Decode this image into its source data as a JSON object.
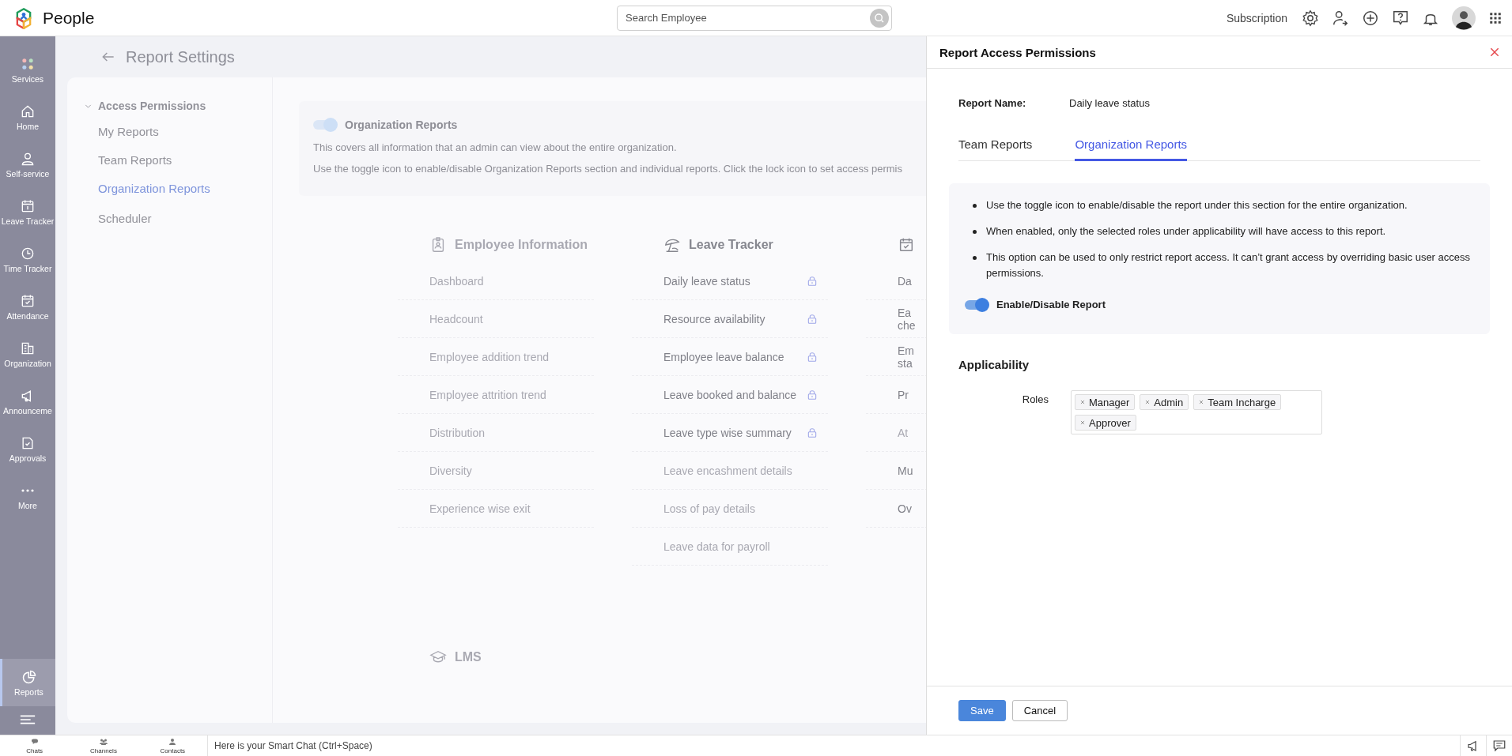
{
  "topbar": {
    "app_name": "People",
    "search": {
      "placeholder": "Search Employee"
    },
    "subscription": "Subscription"
  },
  "sidebar": {
    "items": [
      {
        "label": "Services",
        "selected": false
      },
      {
        "label": "Home",
        "selected": false
      },
      {
        "label": "Self-service",
        "selected": false
      },
      {
        "label": "Leave Tracker",
        "selected": false
      },
      {
        "label": "Time Tracker",
        "selected": false
      },
      {
        "label": "Attendance",
        "selected": false
      },
      {
        "label": "Organization",
        "selected": false
      },
      {
        "label": "Announceme",
        "selected": false
      },
      {
        "label": "Approvals",
        "selected": false
      },
      {
        "label": "More",
        "selected": false
      }
    ],
    "bottom_items": [
      {
        "label": "Reports",
        "selected": true
      }
    ]
  },
  "page": {
    "title": "Report Settings",
    "nav": [
      {
        "label": "Access Permissions",
        "kind": "group",
        "expanded": true,
        "children": [
          {
            "label": "My Reports",
            "selected": false
          },
          {
            "label": "Team Reports",
            "selected": false
          },
          {
            "label": "Organization Reports",
            "selected": true
          }
        ]
      },
      {
        "label": "Scheduler",
        "kind": "link"
      }
    ],
    "section": {
      "title": "Organization Reports",
      "on": true,
      "description": "This covers all information that an admin can view about the entire organization.",
      "hint": "Use the toggle icon to enable/disable Organization Reports section and individual reports. Click the lock icon to set access permis"
    },
    "columns": [
      {
        "title": "Employee Information",
        "enabled": false,
        "items": [
          {
            "label": "Dashboard",
            "enabled": false,
            "locked": false
          },
          {
            "label": "Headcount",
            "enabled": false,
            "locked": false
          },
          {
            "label": "Employee addition trend",
            "enabled": false,
            "locked": false
          },
          {
            "label": "Employee attrition trend",
            "enabled": false,
            "locked": false
          },
          {
            "label": "Distribution",
            "enabled": false,
            "locked": false
          },
          {
            "label": "Diversity",
            "enabled": false,
            "locked": false
          },
          {
            "label": "Experience wise exit",
            "enabled": false,
            "locked": false
          }
        ]
      },
      {
        "title": "Leave Tracker",
        "enabled": true,
        "items": [
          {
            "label": "Daily leave status",
            "enabled": true,
            "locked": true
          },
          {
            "label": "Resource availability",
            "enabled": true,
            "locked": true
          },
          {
            "label": "Employee leave balance",
            "enabled": true,
            "locked": true
          },
          {
            "label": "Leave booked and balance",
            "enabled": true,
            "locked": true
          },
          {
            "label": "Leave type wise summary",
            "enabled": true,
            "locked": true
          },
          {
            "label": "Leave encashment details",
            "enabled": false,
            "locked": false
          },
          {
            "label": "Loss of pay details",
            "enabled": false,
            "locked": false
          },
          {
            "label": "Leave data for payroll",
            "enabled": false,
            "locked": false
          }
        ]
      },
      {
        "enabled": true,
        "items": [
          {
            "label": "Da",
            "enabled": true,
            "locked": false
          },
          {
            "label": "Ea che",
            "enabled": true,
            "locked": false
          },
          {
            "label": "Em sta",
            "enabled": true,
            "locked": false
          },
          {
            "label": "Pr",
            "enabled": true,
            "locked": false
          },
          {
            "label": "At",
            "enabled": false,
            "locked": false
          },
          {
            "label": "Mu",
            "enabled": true,
            "locked": false
          },
          {
            "label": "Ov",
            "enabled": true,
            "locked": false
          }
        ]
      }
    ],
    "lms": {
      "title": "LMS"
    }
  },
  "panel": {
    "title": "Report Access Permissions",
    "report_name_label": "Report Name:",
    "report_name": "Daily leave status",
    "tabs": [
      {
        "label": "Team Reports",
        "selected": false
      },
      {
        "label": "Organization Reports",
        "selected": true
      }
    ],
    "notes": [
      "Use the toggle icon to enable/disable the report under this section for the entire organization.",
      "When enabled, only the selected roles under applicability will have access to this report.",
      "This option can be used to only restrict report access. It can’t grant access by overriding basic user access permissions."
    ],
    "toggle": {
      "label": "Enable/Disable Report",
      "on": true
    },
    "applicability": {
      "title": "Applicability",
      "roles_label": "Roles",
      "roles": [
        "Manager",
        "Admin",
        "Team Incharge",
        "Approver"
      ]
    },
    "buttons": [
      {
        "label": "Save",
        "kind": "primary"
      },
      {
        "label": "Cancel",
        "kind": "secondary"
      }
    ]
  },
  "bottombar": {
    "dock": [
      {
        "label": "Chats"
      },
      {
        "label": "Channels"
      },
      {
        "label": "Contacts"
      }
    ],
    "smart_chat": {
      "placeholder": "Here is your Smart Chat (Ctrl+Space)"
    }
  }
}
